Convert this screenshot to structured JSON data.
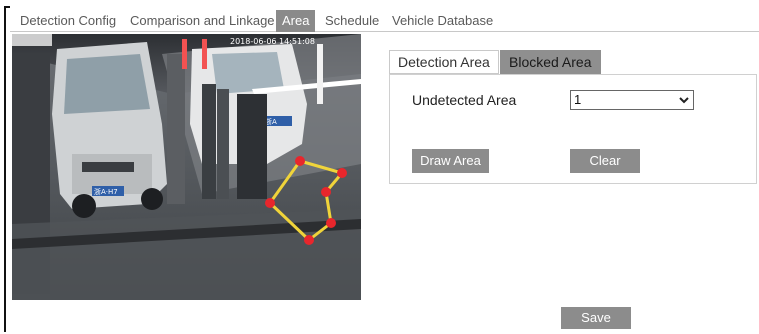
{
  "tabs": [
    {
      "label": "Detection Config"
    },
    {
      "label": "Comparison and Linkage"
    },
    {
      "label": "Area"
    },
    {
      "label": "Schedule"
    },
    {
      "label": "Vehicle Database"
    }
  ],
  "active_tab": "Area",
  "video": {
    "overlay_text": "2018-06-06 14:51:08",
    "plate_left": "浙A·H7",
    "plate_right": "浙A",
    "polygon_color": "#f0d43a",
    "vertex_color": "#e8262c"
  },
  "subtabs": [
    {
      "label": "Detection Area"
    },
    {
      "label": "Blocked Area"
    }
  ],
  "active_subtab": "Blocked Area",
  "panel": {
    "undetected_label": "Undetected Area",
    "undetected_value": "1",
    "draw_label": "Draw Area",
    "clear_label": "Clear"
  },
  "save_label": "Save",
  "colors": {
    "tab_active_bg": "#8a8a8a",
    "button_bg": "#8c8c8c"
  }
}
